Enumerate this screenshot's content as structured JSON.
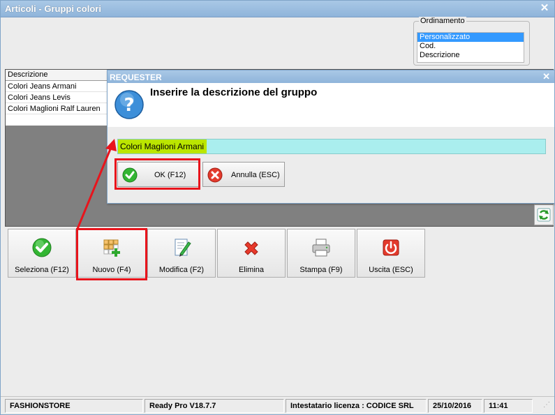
{
  "window": {
    "title": "Articoli - Gruppi colori",
    "close_icon": "close-icon"
  },
  "sort": {
    "legend": "Ordinamento",
    "options": [
      "Personalizzato",
      "Cod.",
      "Descrizione"
    ],
    "selected": "Personalizzato"
  },
  "grid": {
    "column_header": "Descrizione",
    "rows": [
      "Colori Jeans Armani",
      "Colori Jeans Levis",
      "Colori Maglioni Ralf Lauren"
    ]
  },
  "toolbar": {
    "buttons": [
      {
        "label": "Seleziona (F12)",
        "icon": "check-icon"
      },
      {
        "label": "Nuovo (F4)",
        "icon": "new-grid-icon"
      },
      {
        "label": "Modifica (F2)",
        "icon": "edit-icon"
      },
      {
        "label": "Elimina",
        "icon": "delete-icon"
      },
      {
        "label": "Stampa (F9)",
        "icon": "printer-icon"
      },
      {
        "label": "Uscita (ESC)",
        "icon": "exit-icon"
      }
    ]
  },
  "dialog": {
    "title": "REQUESTER",
    "prompt": "Inserire la descrizione del gruppo",
    "input_value": "Colori Maglioni Armani",
    "ok_label": "OK (F12)",
    "cancel_label": "Annulla (ESC)"
  },
  "statusbar": {
    "company": "FASHIONSTORE",
    "version": "Ready Pro V18.7.7",
    "license": "Intestatario licenza : CODICE SRL",
    "date": "25/10/2016",
    "time": "11:41"
  },
  "colors": {
    "accent_title": "#8fb4da",
    "highlight": "#e8141c",
    "input_bg": "#aaeeee",
    "selected_text_bg": "#bbe600"
  }
}
